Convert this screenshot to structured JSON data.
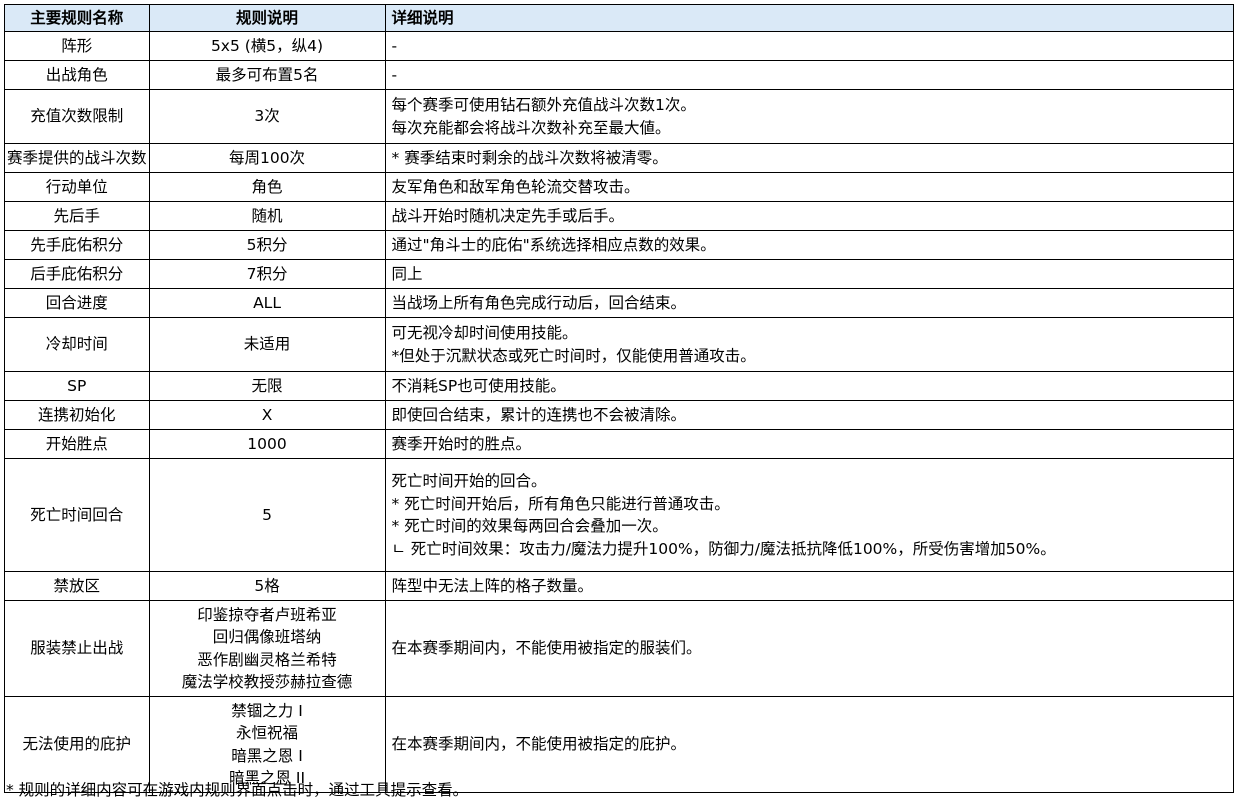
{
  "header": {
    "name": "主要规则名称",
    "rule": "规则说明",
    "detail": "详细说明"
  },
  "rows": [
    {
      "name": "阵形",
      "rule": [
        "5x5 (横5，纵4)"
      ],
      "detail": [
        "-"
      ]
    },
    {
      "name": "出战角色",
      "rule": [
        "最多可布置5名"
      ],
      "detail": [
        "-"
      ]
    },
    {
      "name": "充值次数限制",
      "rule": [
        "3次"
      ],
      "detail": [
        "每个赛季可使用钻石额外充值战斗次数1次。",
        "每次充能都会将战斗次数补充至最大値。"
      ]
    },
    {
      "name": "赛季提供的战斗次数",
      "rule": [
        "每周100次"
      ],
      "detail": [
        "* 赛季结束时剩余的战斗次数将被清零。"
      ]
    },
    {
      "name": "行动单位",
      "rule": [
        "角色"
      ],
      "detail": [
        "友军角色和敌军角色轮流交替攻击。"
      ]
    },
    {
      "name": "先后手",
      "rule": [
        "随机"
      ],
      "detail": [
        "战斗开始时随机决定先手或后手。"
      ]
    },
    {
      "name": "先手庇佑积分",
      "rule": [
        "5积分"
      ],
      "detail": [
        "通过\"角斗士的庇佑\"系统选择相应点数的效果。"
      ]
    },
    {
      "name": "后手庇佑积分",
      "rule": [
        "7积分"
      ],
      "detail": [
        "同上"
      ]
    },
    {
      "name": "回合进度",
      "rule": [
        "ALL"
      ],
      "detail": [
        "当战场上所有角色完成行动后，回合结束。"
      ]
    },
    {
      "name": "冷却时间",
      "rule": [
        "未适用"
      ],
      "detail": [
        "可无视冷却时间使用技能。",
        "*但处于沉默状态或死亡时间时，仅能使用普通攻击。"
      ]
    },
    {
      "name": "SP",
      "rule": [
        "无限"
      ],
      "detail": [
        "不消耗SP也可使用技能。"
      ]
    },
    {
      "name": "连携初始化",
      "rule": [
        "X"
      ],
      "detail": [
        "即使回合结束，累计的连携也不会被清除。"
      ]
    },
    {
      "name": "开始胜点",
      "rule": [
        "1000"
      ],
      "detail": [
        "赛季开始时的胜点。"
      ]
    },
    {
      "name": "死亡时间回合",
      "rule": [
        "5"
      ],
      "detail": [
        "死亡时间开始的回合。",
        "* 死亡时间开始后，所有角色只能进行普通攻击。",
        "* 死亡时间的效果每两回合会叠加一次。",
        "ㄴ 死亡时间效果：攻击力/魔法力提升100%，防御力/魔法抵抗降低100%，所受伤害增加50%。"
      ]
    },
    {
      "name": "禁放区",
      "rule": [
        "5格"
      ],
      "detail": [
        "阵型中无法上阵的格子数量。"
      ]
    },
    {
      "name": "服装禁止出战",
      "rule": [
        "印鉴掠夺者卢班希亚",
        "回归偶像班塔纳",
        "恶作剧幽灵格兰希特",
        "魔法学校教授莎赫拉查德"
      ],
      "detail": [
        "在本赛季期间内，不能使用被指定的服装们。"
      ]
    },
    {
      "name": "无法使用的庇护",
      "rule": [
        "禁锢之力 I",
        "永恒祝福",
        "暗黑之恩 I",
        "暗黑之恩 II"
      ],
      "detail": [
        "在本赛季期间内，不能使用被指定的庇护。"
      ]
    }
  ],
  "footnote": "* 规则的详细内容可在游戏内规则界面点击时，通过工具提示查看。"
}
